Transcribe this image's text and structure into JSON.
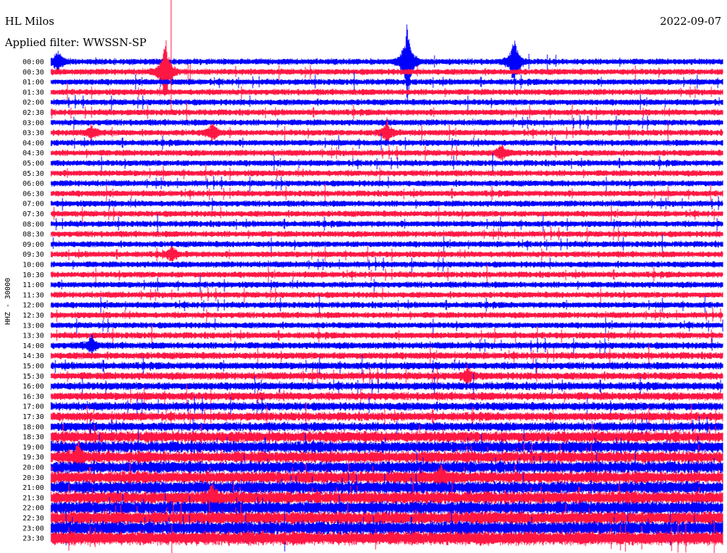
{
  "header": {
    "station": "HL Milos",
    "filter": "Applied filter: WWSSN-SP",
    "date": "2022-09-07"
  },
  "chart_data": {
    "type": "line",
    "title": "HL Milos",
    "subtitle": "Applied filter: WWSSN-SP",
    "date": "2022-09-07",
    "ylabel": "HHZ - 30000",
    "tick_labels": [
      "00:00",
      "00:30",
      "01:00",
      "01:30",
      "02:00",
      "02:30",
      "03:00",
      "03:30",
      "04:00",
      "04:30",
      "05:00",
      "05:30",
      "06:00",
      "06:30",
      "07:00",
      "07:30",
      "08:00",
      "08:30",
      "09:00",
      "09:30",
      "10:00",
      "10:30",
      "11:00",
      "11:30",
      "12:00",
      "12:30",
      "13:00",
      "13:30",
      "14:00",
      "14:30",
      "15:00",
      "15:30",
      "16:00",
      "16:30",
      "17:00",
      "17:30",
      "18:00",
      "18:30",
      "19:00",
      "19:30",
      "20:00",
      "20:30",
      "21:00",
      "21:30",
      "22:00",
      "22:30",
      "23:00",
      "23:30"
    ],
    "colors": [
      "#0000ff",
      "#ff1744"
    ],
    "events": [
      {
        "row": "00:00",
        "position": 0.01,
        "amplitude": 3.5
      },
      {
        "row": "00:00",
        "position": 0.53,
        "amplitude": 14
      },
      {
        "row": "00:00",
        "position": 0.69,
        "amplitude": 9
      },
      {
        "row": "00:30",
        "position": 0.17,
        "amplitude": 12
      },
      {
        "row": "03:30",
        "position": 0.06,
        "amplitude": 2.5
      },
      {
        "row": "03:30",
        "position": 0.24,
        "amplitude": 3
      },
      {
        "row": "03:30",
        "position": 0.5,
        "amplitude": 4
      },
      {
        "row": "04:30",
        "position": 0.67,
        "amplitude": 2.5
      },
      {
        "row": "09:30",
        "position": 0.18,
        "amplitude": 2.5
      },
      {
        "row": "14:00",
        "position": 0.06,
        "amplitude": 3
      },
      {
        "row": "15:30",
        "position": 0.62,
        "amplitude": 3
      },
      {
        "row": "19:30",
        "position": 0.04,
        "amplitude": 4
      },
      {
        "row": "20:30",
        "position": 0.58,
        "amplitude": 3
      },
      {
        "row": "21:30",
        "position": 0.24,
        "amplitude": 3.5
      }
    ]
  }
}
